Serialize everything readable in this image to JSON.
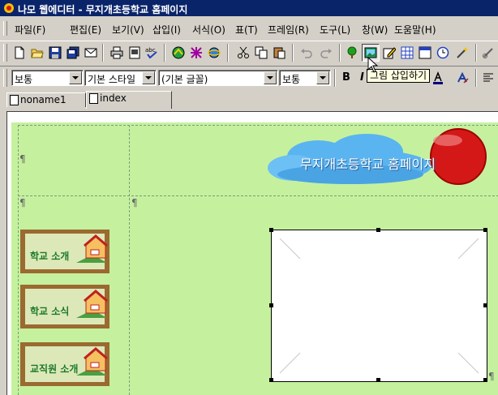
{
  "window": {
    "title": "나모 웹에디터 - 무지개초등학교 홈페이지"
  },
  "menu": [
    "파일(F)",
    "편집(E)",
    "보기(V)",
    "삽입(I)",
    "서식(O)",
    "표(T)",
    "프레임(R)",
    "도구(L)",
    "창(W)",
    "도움말(H)"
  ],
  "format_bar": {
    "paragraph_style": "보통",
    "char_style": "기본 스타일",
    "font": "(기본 글꼴)",
    "size": "보통",
    "bold_label": "B",
    "italic_label": "I"
  },
  "tooltip": "그림 삽입하기",
  "tabs": [
    "noname1",
    "index"
  ],
  "page": {
    "banner_text": "무지개초등학교 홈페이지",
    "paragraph_mark": "¶",
    "nav_buttons": [
      "학교 소개",
      "학교 소식",
      "교직원 소개"
    ]
  },
  "colors": {
    "titlebar": "#0a246a",
    "page_bg": "#c5f19e",
    "nav_text": "#1a7a2a",
    "banner_red": "#d41818",
    "cloud": "#5ab4f0"
  },
  "icons": [
    "new-icon",
    "open-icon",
    "save-icon",
    "save-all-icon",
    "mail-icon",
    "print-icon",
    "preview-icon",
    "spell-check-icon",
    "publish-icon",
    "link-check-icon",
    "browser-icon",
    "cut-icon",
    "copy-icon",
    "paste-icon",
    "undo-icon",
    "redo-icon",
    "tree-icon",
    "insert-image-icon",
    "edit-icon",
    "table-icon",
    "frame-icon",
    "clock-icon",
    "wand-icon",
    "link-icon"
  ]
}
